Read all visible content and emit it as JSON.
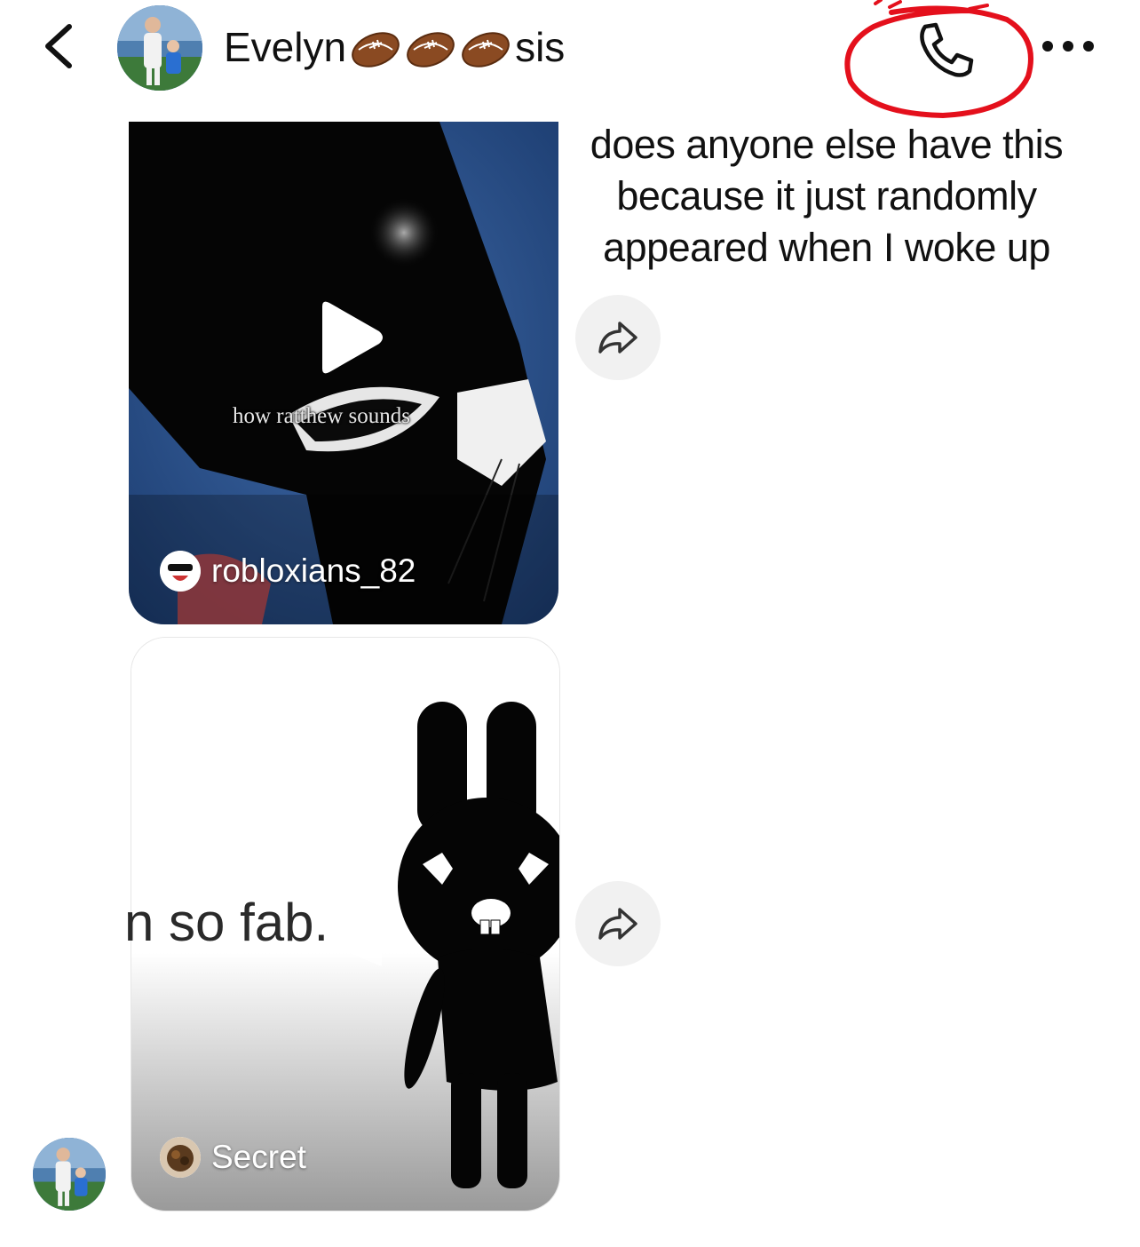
{
  "header": {
    "contact_name": "Evelyn",
    "contact_suffix": "sis",
    "emoji_count": 3,
    "icons": [
      "chevron-left-icon",
      "phone-icon",
      "more-horizontal-icon"
    ],
    "annotation_color": "#e4101c"
  },
  "messages": [
    {
      "type": "shared-video",
      "overlay_caption": "how ratthew sounds",
      "username": "robloxians_82"
    },
    {
      "type": "text",
      "text": "does anyone else have this because it just randomly appeared when I woke up"
    },
    {
      "type": "shared-video",
      "overlay_caption": "n so fab.",
      "username": "Secret"
    }
  ]
}
